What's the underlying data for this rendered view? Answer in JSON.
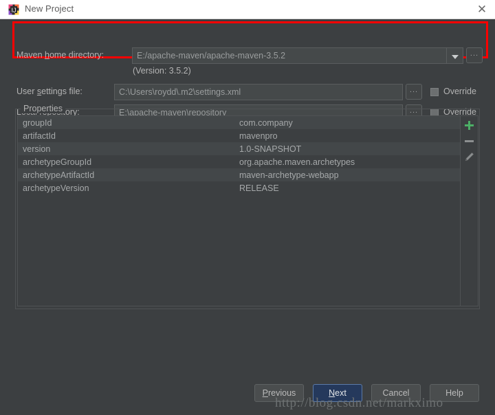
{
  "window": {
    "title": "New Project",
    "app_icon": "intellij-idea-icon",
    "close_icon": "close-icon"
  },
  "maven_home": {
    "label_pre": "Maven ",
    "label_accel": "h",
    "label_post": "ome directory:",
    "value": "E:/apache-maven/apache-maven-3.5.2",
    "dropdown_icon": "chevron-down-icon",
    "browse_label": "...",
    "version_note": "(Version: 3.5.2)"
  },
  "user_settings": {
    "label_pre": "User ",
    "label_accel": "s",
    "label_post": "ettings file:",
    "value": "C:\\Users\\roydd\\.m2\\settings.xml",
    "browse_label": "...",
    "override_label": "Override",
    "override_checked": false
  },
  "local_repository": {
    "label_pre": "Local ",
    "label_accel": "r",
    "label_post": "epository:",
    "value": "E:\\apache-maven\\repository",
    "browse_label": "...",
    "override_label": "Override",
    "override_checked": false
  },
  "properties": {
    "group_title": "Properties",
    "rows": [
      {
        "key": "groupId",
        "value": "com.company"
      },
      {
        "key": "artifactId",
        "value": "mavenpro"
      },
      {
        "key": "version",
        "value": "1.0-SNAPSHOT"
      },
      {
        "key": "archetypeGroupId",
        "value": "org.apache.maven.archetypes"
      },
      {
        "key": "archetypeArtifactId",
        "value": "maven-archetype-webapp"
      },
      {
        "key": "archetypeVersion",
        "value": "RELEASE"
      }
    ],
    "toolbar": {
      "add_icon": "plus-icon",
      "remove_icon": "minus-icon",
      "edit_icon": "pencil-icon"
    }
  },
  "footer": {
    "previous": {
      "pre": "",
      "accel": "P",
      "post": "revious"
    },
    "next": {
      "pre": "",
      "accel": "N",
      "post": "ext"
    },
    "cancel": {
      "label": "Cancel"
    },
    "help": {
      "label": "Help"
    }
  },
  "watermark": {
    "text": "http://blog.csdn.net/markximo"
  },
  "colors": {
    "window_bg": "#3c3f41",
    "titlebar_bg": "#ffffff",
    "field_bg": "#45494a",
    "accent_primary": "#25395c",
    "annotation_red": "#fd0000",
    "add_green": "#4caf66"
  }
}
